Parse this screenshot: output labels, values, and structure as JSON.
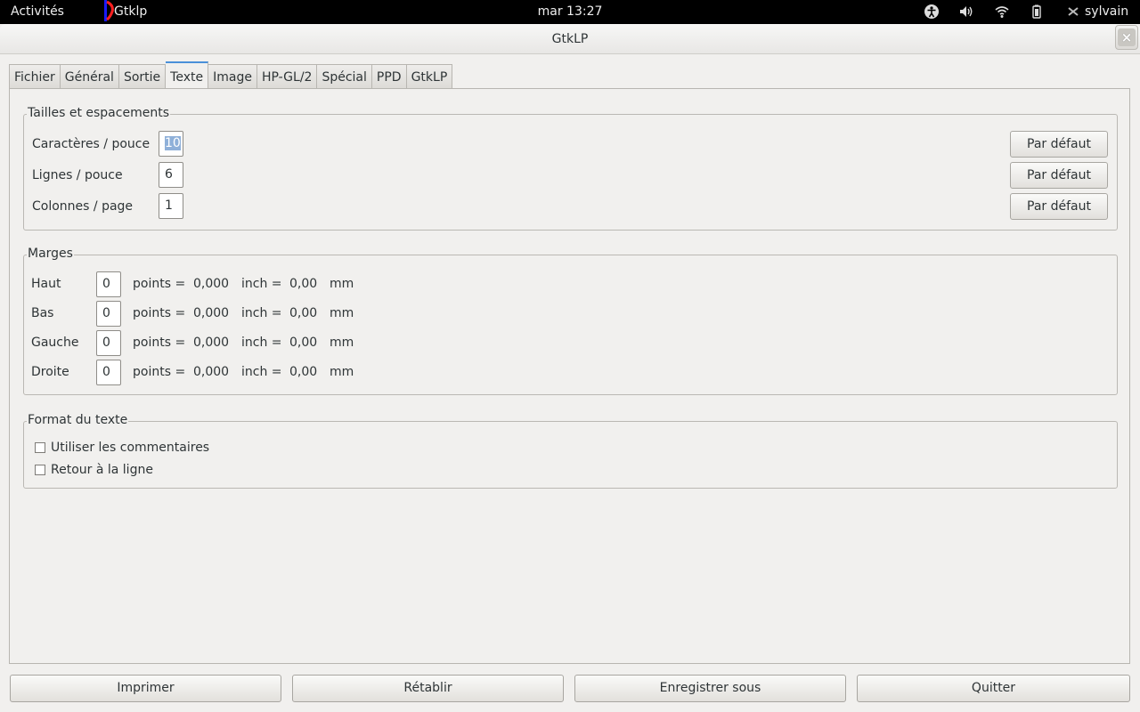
{
  "topbar": {
    "activities": "Activités",
    "app_name": "Gtklp",
    "clock": "mar 13:27",
    "user": "sylvain",
    "icons": [
      "accessibility-icon",
      "volume-icon",
      "wifi-icon",
      "battery-icon",
      "user-status-icon"
    ]
  },
  "window": {
    "title": "GtkLP",
    "close_label": "×"
  },
  "tabs": [
    "Fichier",
    "Général",
    "Sortie",
    "Texte",
    "Image",
    "HP-GL/2",
    "Spécial",
    "PPD",
    "GtkLP"
  ],
  "active_tab": "Texte",
  "sizes": {
    "legend": "Tailles et espacements",
    "rows": [
      {
        "label": "Caractères / pouce",
        "value": "10",
        "button": "Par défaut"
      },
      {
        "label": "Lignes / pouce",
        "value": "6",
        "button": "Par défaut"
      },
      {
        "label": "Colonnes / page",
        "value": "1",
        "button": "Par défaut"
      }
    ]
  },
  "margins": {
    "legend": "Marges",
    "rows": [
      {
        "label": "Haut",
        "value": "0",
        "points": "points =",
        "inch_val": "0,000",
        "inch": "inch =",
        "mm_val": "0,00",
        "mm": "mm"
      },
      {
        "label": "Bas",
        "value": "0",
        "points": "points =",
        "inch_val": "0,000",
        "inch": "inch =",
        "mm_val": "0,00",
        "mm": "mm"
      },
      {
        "label": "Gauche",
        "value": "0",
        "points": "points =",
        "inch_val": "0,000",
        "inch": "inch =",
        "mm_val": "0,00",
        "mm": "mm"
      },
      {
        "label": "Droite",
        "value": "0",
        "points": "points =",
        "inch_val": "0,000",
        "inch": "inch =",
        "mm_val": "0,00",
        "mm": "mm"
      }
    ]
  },
  "format": {
    "legend": "Format du texte",
    "options": [
      {
        "label": "Utiliser les commentaires",
        "checked": false
      },
      {
        "label": "Retour à la ligne",
        "checked": false
      }
    ]
  },
  "footer": {
    "print": "Imprimer",
    "reset": "Rétablir",
    "save_as": "Enregistrer sous",
    "quit": "Quitter"
  },
  "colors": {
    "topbar_bg": "#000000",
    "window_bg": "#f1f0ee",
    "tab_accent": "#4a90d9",
    "selection": "#8fb0d9"
  }
}
